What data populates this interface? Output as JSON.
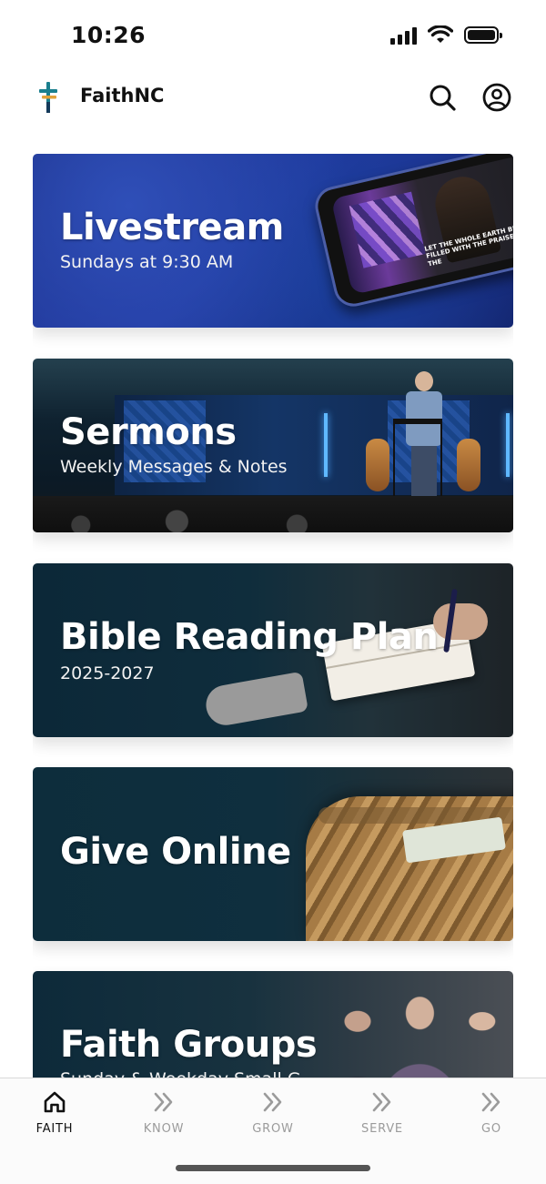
{
  "status_bar": {
    "time": "10:26"
  },
  "header": {
    "app_name": "FaithNC",
    "logo_icon": "cross-logo-icon",
    "accent": "#1a7f8e"
  },
  "cards": [
    {
      "title": "Livestream",
      "subtitle": "Sundays at 9:30 AM"
    },
    {
      "title": "Sermons",
      "subtitle": "Weekly Messages & Notes"
    },
    {
      "title": "Bible Reading Plan",
      "subtitle": "2025-2027"
    },
    {
      "title": "Give Online",
      "subtitle": ""
    },
    {
      "title": "Faith Groups",
      "subtitle": "Sunday & Weekday Small G"
    }
  ],
  "livestream_screen_caption": "LET THE WHOLE EARTH BE FILLED WITH THE PRAISES OF THE",
  "tab_bar": {
    "tabs": [
      {
        "label": "FAITH",
        "icon": "home-icon",
        "active": true
      },
      {
        "label": "KNOW",
        "icon": "chevrons-right-icon",
        "active": false
      },
      {
        "label": "GROW",
        "icon": "chevrons-right-icon",
        "active": false
      },
      {
        "label": "SERVE",
        "icon": "chevrons-right-icon",
        "active": false
      },
      {
        "label": "GO",
        "icon": "chevrons-right-icon",
        "active": false
      }
    ]
  }
}
